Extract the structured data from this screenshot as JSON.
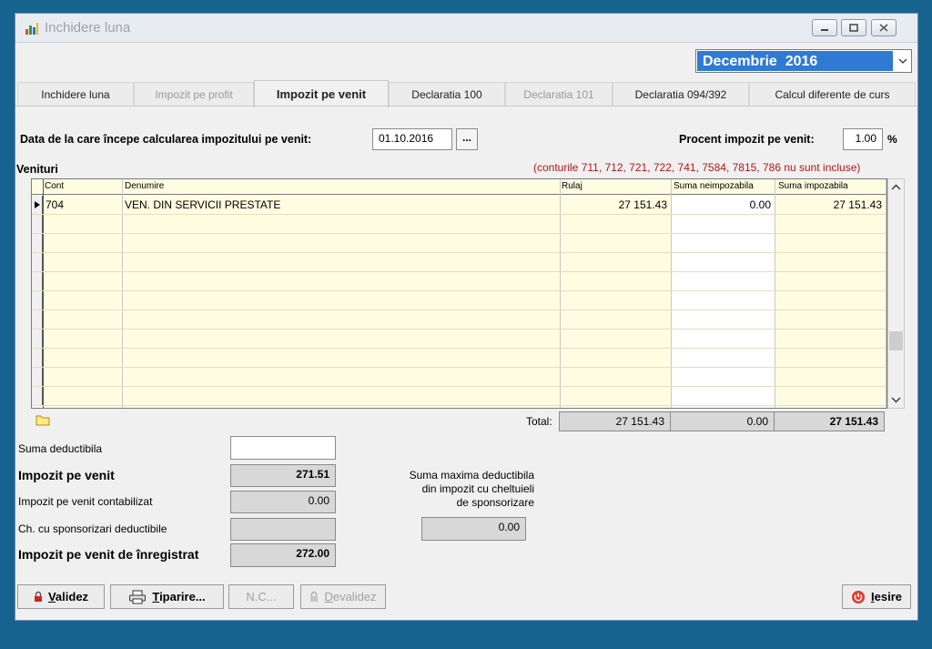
{
  "window": {
    "title": "Inchidere luna"
  },
  "period": {
    "selected": "Decembrie  2016"
  },
  "tabs": [
    {
      "label": "Inchidere luna",
      "state": "normal"
    },
    {
      "label": "Impozit pe profit",
      "state": "disabled"
    },
    {
      "label": "Impozit pe venit",
      "state": "active"
    },
    {
      "label": "Declaratia 100",
      "state": "normal"
    },
    {
      "label": "Declaratia 101",
      "state": "disabled"
    },
    {
      "label": "Declaratia 094/392",
      "state": "normal"
    },
    {
      "label": "Calcul diferente de curs",
      "state": "normal"
    }
  ],
  "form": {
    "start_date_label": "Data de la care începe calcularea impozitului pe venit:",
    "start_date_value": "01.10.2016",
    "picker_label": "...",
    "percent_label": "Procent impozit pe venit:",
    "percent_value": "1.00",
    "percent_unit": "%"
  },
  "revenues": {
    "title": "Venituri",
    "note": "(conturile 711, 712, 721, 722, 741, 7584, 7815, 786 nu sunt incluse)",
    "columns": [
      "Cont",
      "Denumire",
      "Rulaj",
      "Suma neimpozabila",
      "Suma impozabila"
    ],
    "rows": [
      {
        "cont": "704",
        "denumire": "VEN. DIN SERVICII PRESTATE",
        "rulaj": "27 151.43",
        "neimpozabila": "0.00",
        "impozabila": "27 151.43"
      }
    ],
    "total_label": "Total:",
    "total_rulaj": "27 151.43",
    "total_neimpozabila": "0.00",
    "total_impozabila": "27 151.43"
  },
  "summary": {
    "suma_deductibila_label": "Suma deductibila",
    "suma_deductibila_value": "",
    "impozit_label": "Impozit pe venit",
    "impozit_value": "271.51",
    "contabilizat_label": "Impozit pe venit contabilizat",
    "contabilizat_value": "0.00",
    "sponsorizari_label": "Ch. cu sponsorizari deductibile",
    "sponsorizari_value": "",
    "de_inregistrat_label": "Impozit pe venit de înregistrat",
    "de_inregistrat_value": "272.00",
    "max_deductibila_line1": "Suma maxima deductibila",
    "max_deductibila_line2": "din impozit cu cheltuieli",
    "max_deductibila_line3": "de sponsorizare",
    "max_deductibila_value": "0.00"
  },
  "buttons": {
    "validez_rest": "alidez",
    "validez_key": "V",
    "tiparire_key": "T",
    "tiparire_rest": "iparire...",
    "nc": "N.C...",
    "devalidez_key": "D",
    "devalidez_rest": "evalidez",
    "iesire_key": "I",
    "iesire_rest": "esire"
  }
}
